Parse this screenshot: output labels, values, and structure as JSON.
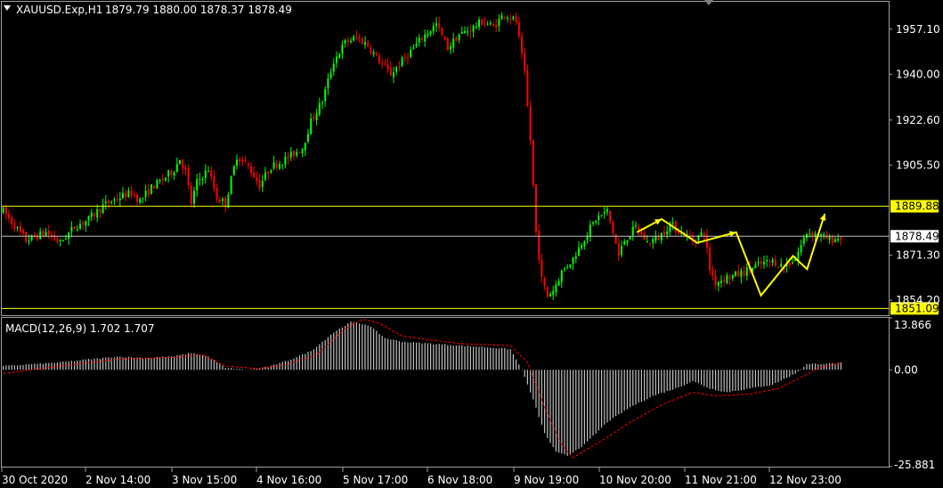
{
  "header": {
    "symbol": "XAUUSD.Exp,H1",
    "ohlc": "1879.79 1880.00 1878.37 1878.49"
  },
  "chart_data": [
    {
      "type": "candlestick",
      "title": "",
      "ylim": [
        1848.5,
        1967.5
      ],
      "yticks": [
        1957.1,
        1940.0,
        1922.6,
        1905.5,
        1871.3,
        1854.2
      ],
      "ytick_labels": [
        "1957.10",
        "1940.00",
        "1922.60",
        "1905.50",
        "1871.30",
        "1854.20"
      ],
      "current_price": 1878.49,
      "current_price_label": "1878.49",
      "hlines": [
        {
          "value": 1889.88,
          "label": "1889.88",
          "color": "#ffff00"
        },
        {
          "value": 1851.09,
          "label": "1851.09",
          "color": "#ffff00"
        }
      ],
      "colors": {
        "up": "#00ff00",
        "down": "#ff0000",
        "current": "#c0c0c0",
        "forecast": "#ffff00"
      },
      "xticks": [
        "30 Oct 2020",
        "2 Nov 14:00",
        "3 Nov 15:00",
        "4 Nov 16:00",
        "5 Nov 17:00",
        "6 Nov 18:00",
        "9 Nov 19:00",
        "10 Nov 20:00",
        "11 Nov 21:00",
        "12 Nov 23:00"
      ],
      "close_path": [
        [
          0,
          1888
        ],
        [
          8,
          1877
        ],
        [
          15,
          1880
        ],
        [
          20,
          1876
        ],
        [
          25,
          1882
        ],
        [
          30,
          1885
        ],
        [
          35,
          1890
        ],
        [
          40,
          1893
        ],
        [
          45,
          1895
        ],
        [
          48,
          1892
        ],
        [
          52,
          1897
        ],
        [
          56,
          1900
        ],
        [
          60,
          1904
        ],
        [
          62,
          1908
        ],
        [
          64,
          1903
        ],
        [
          66,
          1891
        ],
        [
          68,
          1899
        ],
        [
          72,
          1904
        ],
        [
          75,
          1893
        ],
        [
          78,
          1891
        ],
        [
          82,
          1909
        ],
        [
          86,
          1905
        ],
        [
          90,
          1898
        ],
        [
          94,
          1905
        ],
        [
          98,
          1907
        ],
        [
          102,
          1910
        ],
        [
          105,
          1912
        ],
        [
          108,
          1922
        ],
        [
          112,
          1930
        ],
        [
          116,
          1945
        ],
        [
          120,
          1952
        ],
        [
          124,
          1954
        ],
        [
          128,
          1951
        ],
        [
          132,
          1945
        ],
        [
          136,
          1940
        ],
        [
          140,
          1945
        ],
        [
          144,
          1950
        ],
        [
          148,
          1955
        ],
        [
          152,
          1959
        ],
        [
          156,
          1950
        ],
        [
          160,
          1955
        ],
        [
          164,
          1957
        ],
        [
          168,
          1960
        ],
        [
          172,
          1958
        ],
        [
          176,
          1963
        ],
        [
          180,
          1960
        ],
        [
          183,
          1940
        ],
        [
          185,
          1915
        ],
        [
          187,
          1880
        ],
        [
          189,
          1862
        ],
        [
          191,
          1856
        ],
        [
          193,
          1858
        ],
        [
          196,
          1865
        ],
        [
          200,
          1870
        ],
        [
          204,
          1878
        ],
        [
          208,
          1885
        ],
        [
          212,
          1888
        ],
        [
          214,
          1880
        ],
        [
          216,
          1871
        ],
        [
          218,
          1877
        ],
        [
          222,
          1882
        ],
        [
          226,
          1876
        ],
        [
          230,
          1878
        ],
        [
          234,
          1883
        ],
        [
          238,
          1880
        ],
        [
          242,
          1877
        ],
        [
          246,
          1880
        ],
        [
          248,
          1866
        ],
        [
          250,
          1861
        ],
        [
          254,
          1863
        ],
        [
          258,
          1864
        ],
        [
          262,
          1866
        ],
        [
          266,
          1868
        ],
        [
          270,
          1869
        ],
        [
          274,
          1867
        ],
        [
          278,
          1870
        ],
        [
          282,
          1880
        ],
        [
          286,
          1879
        ],
        [
          290,
          1877
        ],
        [
          294,
          1878
        ]
      ],
      "forecast_path": [
        [
          1879,
          1880
        ],
        [
          1886,
          1885
        ],
        [
          1896,
          1876
        ],
        [
          1907,
          1880
        ],
        [
          1914,
          1856
        ],
        [
          1923,
          1871
        ],
        [
          1927,
          1866
        ],
        [
          1932,
          1887
        ]
      ]
    },
    {
      "type": "bar",
      "title": "MACD(12,26,9) 1.702 1.707",
      "ylim": [
        -25.881,
        13.866
      ],
      "ytick_labels": [
        "13.866",
        "0.00",
        "-25.881"
      ],
      "yticks": [
        13.866,
        0,
        -25.881
      ],
      "colors": {
        "histogram": "#c0c0c0",
        "signal": "#ff0000"
      },
      "macd_path": [
        [
          0,
          1
        ],
        [
          10,
          1.5
        ],
        [
          20,
          2
        ],
        [
          30,
          2.8
        ],
        [
          40,
          3.5
        ],
        [
          50,
          3.2
        ],
        [
          60,
          3.6
        ],
        [
          66,
          4.5
        ],
        [
          72,
          3.5
        ],
        [
          78,
          0.5
        ],
        [
          86,
          0
        ],
        [
          94,
          1
        ],
        [
          100,
          2.5
        ],
        [
          108,
          5
        ],
        [
          116,
          10
        ],
        [
          122,
          12.8
        ],
        [
          128,
          12
        ],
        [
          134,
          8.5
        ],
        [
          140,
          7.5
        ],
        [
          150,
          7
        ],
        [
          160,
          6.5
        ],
        [
          170,
          6
        ],
        [
          178,
          5.5
        ],
        [
          182,
          0
        ],
        [
          186,
          -8
        ],
        [
          190,
          -17
        ],
        [
          194,
          -22
        ],
        [
          198,
          -23
        ],
        [
          204,
          -20
        ],
        [
          212,
          -14
        ],
        [
          220,
          -10
        ],
        [
          228,
          -7
        ],
        [
          236,
          -5
        ],
        [
          242,
          -3
        ],
        [
          248,
          -5
        ],
        [
          254,
          -6
        ],
        [
          262,
          -5
        ],
        [
          270,
          -4
        ],
        [
          278,
          -1
        ],
        [
          282,
          1.5
        ],
        [
          294,
          1.8
        ]
      ],
      "signal_path": [
        [
          0,
          -1
        ],
        [
          20,
          1
        ],
        [
          40,
          2.8
        ],
        [
          60,
          3.3
        ],
        [
          70,
          4
        ],
        [
          78,
          1
        ],
        [
          90,
          0.3
        ],
        [
          100,
          1.5
        ],
        [
          110,
          4
        ],
        [
          120,
          11
        ],
        [
          126,
          13.5
        ],
        [
          132,
          12.5
        ],
        [
          140,
          9
        ],
        [
          160,
          7
        ],
        [
          178,
          6.5
        ],
        [
          184,
          2
        ],
        [
          190,
          -10
        ],
        [
          196,
          -20
        ],
        [
          200,
          -23.5
        ],
        [
          210,
          -19
        ],
        [
          220,
          -14
        ],
        [
          232,
          -9
        ],
        [
          242,
          -6
        ],
        [
          250,
          -7
        ],
        [
          262,
          -6.5
        ],
        [
          272,
          -5
        ],
        [
          280,
          -2
        ],
        [
          286,
          0.5
        ],
        [
          294,
          1.7
        ]
      ]
    }
  ]
}
